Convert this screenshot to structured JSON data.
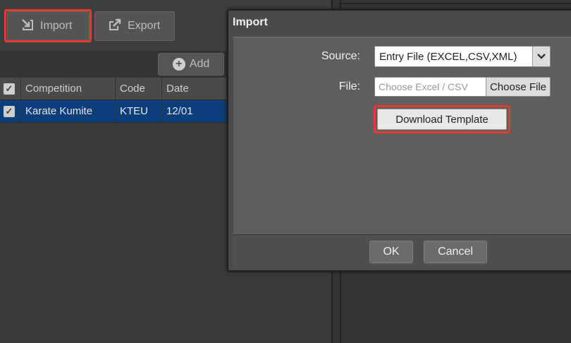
{
  "toolbar": {
    "import_label": "Import",
    "export_label": "Export",
    "import_icon": "import-icon",
    "export_icon": "export-icon"
  },
  "actions": {
    "add_label": "Add",
    "add_icon": "plus-circle-icon"
  },
  "grid": {
    "columns": [
      "Competition",
      "Code",
      "Date"
    ],
    "rows": [
      {
        "competition": "Karate Kumite",
        "code": "KTEU",
        "date": "12/01",
        "checked": true
      }
    ]
  },
  "dialog": {
    "title": "Import",
    "source_label": "Source:",
    "source_value": "Entry File (EXCEL,CSV,XML)",
    "file_label": "File:",
    "file_placeholder": "Choose Excel / CSV",
    "choose_file_label": "Choose File",
    "download_template_label": "Download Template",
    "ok_label": "OK",
    "cancel_label": "Cancel"
  },
  "colors": {
    "highlight": "#e53935",
    "selected_row": "#0b3e7a"
  }
}
